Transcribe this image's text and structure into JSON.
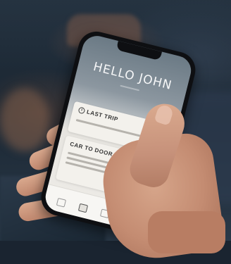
{
  "photo": {
    "subject": "hand-holding-smartphone"
  },
  "phone_app": {
    "greeting": "HELLO JOHN",
    "cards": [
      {
        "title": "LAST TRIP"
      },
      {
        "title": "CAR TO DOOR"
      }
    ],
    "tab_count": 4
  },
  "colors": {
    "skin": "#c48c72",
    "phone_body": "#0e0f12",
    "card_bg": "#f3f1ec",
    "background_blue": "#1b2733"
  }
}
